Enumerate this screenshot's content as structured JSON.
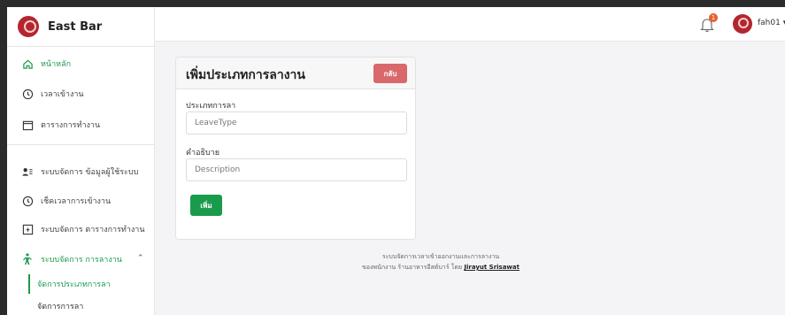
{
  "brand": {
    "name": "East Bar"
  },
  "sidebar": {
    "items": [
      {
        "label": "หน้าหลัก",
        "icon": "home-icon"
      },
      {
        "label": "เวลาเข้างาน",
        "icon": "clock-icon"
      },
      {
        "label": "ตารางการทำงาน",
        "icon": "calendar-icon"
      },
      {
        "label": "ระบบจัดการ ข้อมูลผู้ใช้ระบบ",
        "icon": "users-icon"
      },
      {
        "label": "เช็คเวลาการเข้างาน",
        "icon": "clock-icon"
      },
      {
        "label": "ระบบจัดการ ตารางการทำงาน",
        "icon": "calendar-plus-icon"
      },
      {
        "label": "ระบบจัดการ การลางาน",
        "icon": "person-walking-icon"
      }
    ],
    "sub_items": [
      {
        "label": "จัดการประเภทการลา"
      },
      {
        "label": "จัดการการลา"
      }
    ]
  },
  "topbar": {
    "notification_count": "1",
    "username": "fah01"
  },
  "form": {
    "title": "เพิ่มประเภทการลางาน",
    "back_label": "กลับ",
    "leave_type_label": "ประเภทการลา",
    "leave_type_placeholder": "LeaveType",
    "description_label": "คำอธิบาย",
    "description_placeholder": "Description",
    "submit_label": "เพิ่ม"
  },
  "footer": {
    "line1": "ระบบจัดการเวลาเข้าออกงานและการลางาน",
    "line2_prefix": "ของพนักงาน ร้านอาหารอีสต์บาร์ โดย",
    "author": "Jirayut Srisawat"
  },
  "colors": {
    "accent": "#1a9b4c",
    "danger": "#d9686a",
    "brand": "#b3262f",
    "badge": "#e8602c"
  }
}
